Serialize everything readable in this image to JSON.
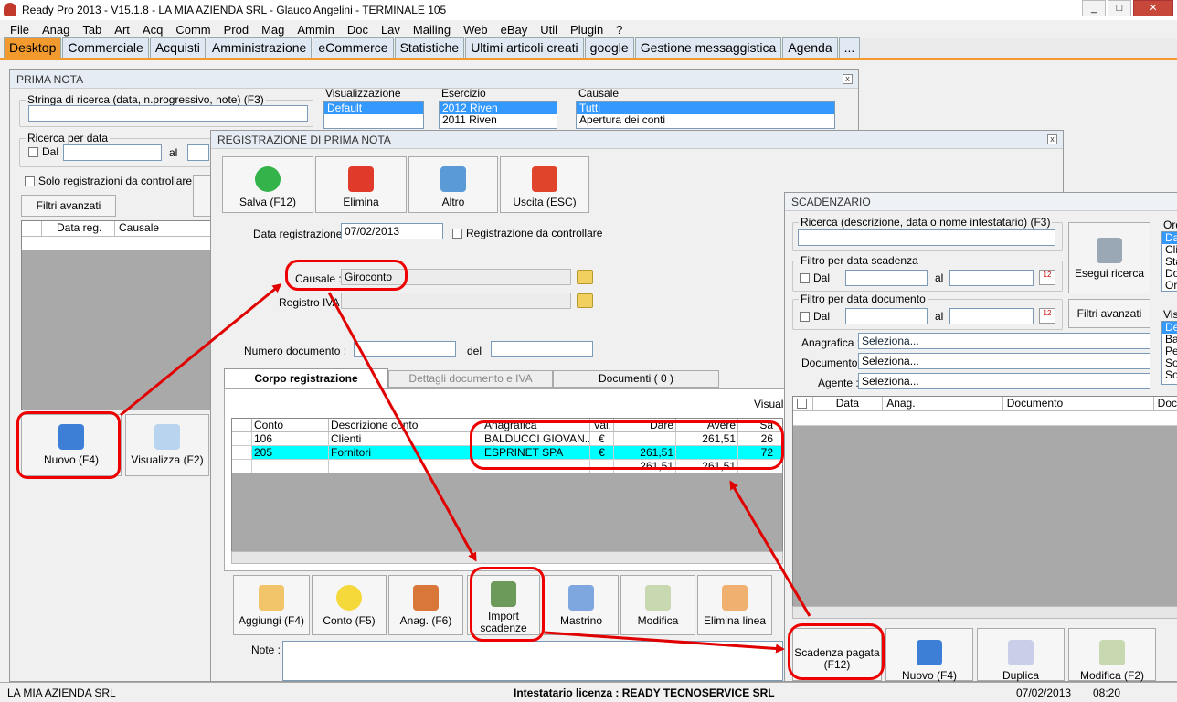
{
  "window": {
    "title": "Ready Pro 2013 - V15.1.8 - LA MIA AZIENDA SRL - Glauco Angelini - TERMINALE 105"
  },
  "menu": [
    "File",
    "Anag",
    "Tab",
    "Art",
    "Acq",
    "Comm",
    "Prod",
    "Mag",
    "Ammin",
    "Doc",
    "Lav",
    "Mailing",
    "Web",
    "eBay",
    "Util",
    "Plugin",
    "?"
  ],
  "tabs": [
    "Desktop",
    "Commerciale",
    "Acquisti",
    "Amministrazione",
    "eCommerce",
    "Statistiche",
    "Ultimi articoli creati",
    "google",
    "Gestione messaggistica",
    "Agenda",
    "..."
  ],
  "prima_nota": {
    "title": "PRIMA NOTA",
    "search_label": "Stringa di ricerca (data, n.progressivo, note) (F3)",
    "visualizzazione_label": "Visualizzazione",
    "visualizzazione_items": [
      "Default"
    ],
    "esercizio_label": "Esercizio",
    "esercizio_items": [
      "2012 Riven",
      "2011 Riven"
    ],
    "causale_label": "Causale",
    "causale_items": [
      "Tutti",
      "Apertura dei conti"
    ],
    "ricerca_data_label": "Ricerca per data",
    "dal": "Dal",
    "al": "al",
    "solo_controllare": "Solo registrazioni da controllare",
    "filtri_avanzati": "Filtri avanzati",
    "grid_cols": [
      "Data reg.",
      "Causale"
    ],
    "nuovo": "Nuovo (F4)",
    "visualizza": "Visualizza (F2)"
  },
  "registrazione": {
    "title": "REGISTRAZIONE DI PRIMA NOTA",
    "toolbar": [
      "Salva (F12)",
      "Elimina",
      "Altro",
      "Uscita (ESC)"
    ],
    "data_label": "Data registrazione :",
    "data_value": "07/02/2013",
    "controllare_label": "Registrazione da controllare",
    "causale_label": "Causale :",
    "causale_value": "Giroconto",
    "registro_label": "Registro IVA :",
    "numero_label": "Numero documento :",
    "del_label": "del",
    "tabs": [
      "Corpo registrazione",
      "Dettagli documento e IVA",
      "Documenti ( 0 )"
    ],
    "visualizza_label": "Visualiz",
    "grid_cols": [
      "Conto",
      "Descrizione conto",
      "Anagrafica",
      "Val.",
      "Dare",
      "Avere",
      "Sa"
    ],
    "rows": [
      {
        "conto": "106",
        "descr": "Clienti",
        "anag": "BALDUCCI GIOVAN...",
        "val": "€",
        "dare": "",
        "avere": "261,51",
        "saldo": "26"
      },
      {
        "conto": "205",
        "descr": "Fornitori",
        "anag": "ESPRINET SPA",
        "val": "€",
        "dare": "261,51",
        "avere": "",
        "saldo": "72"
      }
    ],
    "totals": {
      "dare": "261,51",
      "avere": "261,51"
    },
    "bottom_buttons": [
      "Aggiungi (F4)",
      "Conto (F5)",
      "Anag. (F6)",
      "Import scadenze",
      "Mastrino",
      "Modifica",
      "Elimina linea"
    ],
    "note_label": "Note :"
  },
  "scadenzario": {
    "title": "SCADENZARIO",
    "ricerca_label": "Ricerca (descrizione, data o nome intestatario) (F3)",
    "filtro_scadenza": "Filtro per data scadenza",
    "filtro_documento": "Filtro per data documento",
    "dal": "Dal",
    "al": "al",
    "esegui": "Esegui ricerca",
    "filtri_avanzati": "Filtri avanzati",
    "ord_label": "Ord",
    "ord_items": [
      "Da",
      "Clie",
      "Sta",
      "Do",
      "Ord"
    ],
    "vis_label": "Vis",
    "vis_items": [
      "De",
      "Ba",
      "Per",
      "Sol",
      "Sol"
    ],
    "anagrafica_label": "Anagrafica :",
    "documento_label": "Documento :",
    "agente_label": "Agente :",
    "seleziona": "Seleziona...",
    "grid_cols": [
      "Data",
      "Anag.",
      "Documento",
      "Doc"
    ],
    "bottom_buttons": [
      "Scadenza pagata (F12)",
      "Nuovo (F4)",
      "Duplica",
      "Modifica (F2)"
    ]
  },
  "status": {
    "company": "LA MIA AZIENDA SRL",
    "license": "Intestatario licenza : READY TECNOSERVICE SRL",
    "date": "07/02/2013",
    "time": "08:20"
  },
  "colors": {
    "accent": "#f29a2e",
    "selection": "#3399ff",
    "highlight_row": "#00ffff",
    "annotation": "#e00000"
  }
}
